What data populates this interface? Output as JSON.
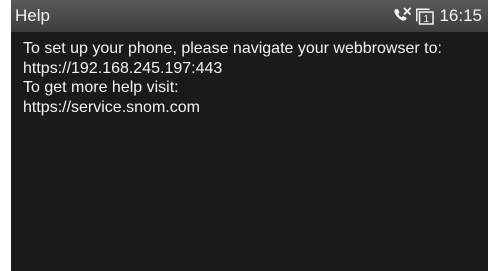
{
  "status_bar": {
    "title": "Help",
    "icons": [
      "missed-call-icon",
      "line-key-icon"
    ],
    "line_number": "1",
    "time": "16:15"
  },
  "content": {
    "lines": [
      "To set up your phone, please navigate your webbrowser to:",
      "https://192.168.245.197:443",
      "To get more help visit:",
      "https://service.snom.com"
    ]
  },
  "colors": {
    "screen_background": "#1a1a1a",
    "status_bar_top": "#5a5a5a",
    "status_bar_bottom": "#3d3d3d",
    "text": "#f2f2f2",
    "frame": "#ffffff"
  }
}
